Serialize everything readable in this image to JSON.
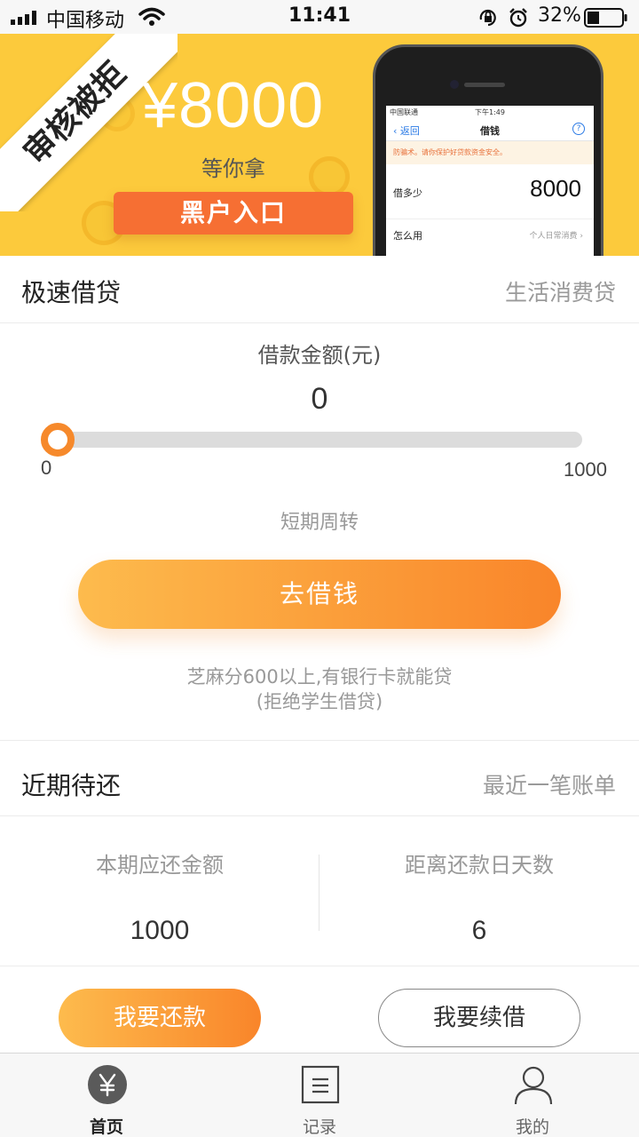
{
  "status_bar": {
    "carrier": "中国移动",
    "time": "11:41",
    "battery": "32%"
  },
  "banner": {
    "ribbon": "审核被拒",
    "amount": "¥8000",
    "subtitle": "等你拿",
    "button": "黑户入口",
    "phone": {
      "carrier": "中国联通",
      "time": "下午1:49",
      "back": "返回",
      "title": "借钱",
      "help": "?",
      "notice": "防骗术。请你保护好贷款资金安全。",
      "row1_label": "借多少",
      "row1_value": "8000",
      "row2_label": "怎么用",
      "row2_value": "个人日常消费 ›"
    }
  },
  "loan_section": {
    "title": "极速借贷",
    "side": "生活消费贷",
    "amount_label": "借款金额(元)",
    "amount_value": "0",
    "slider_min": "0",
    "slider_max": "1000",
    "slider_level": 0,
    "loan_type": "短期周转",
    "borrow_button": "去借钱",
    "note_line1": "芝麻分600以上,有银行卡就能贷",
    "note_line2": "(拒绝学生借贷)"
  },
  "repay_section": {
    "title": "近期待还",
    "side": "最近一笔账单",
    "due_label": "本期应还金额",
    "due_value": "1000",
    "days_label": "距离还款日天数",
    "days_value": "6",
    "repay_button": "我要还款",
    "renew_button": "我要续借"
  },
  "tabbar": {
    "items": [
      {
        "label": "首页",
        "icon": "yuan-icon",
        "active": true
      },
      {
        "label": "记录",
        "icon": "records-icon",
        "active": false
      },
      {
        "label": "我的",
        "icon": "user-icon",
        "active": false
      }
    ]
  },
  "colors": {
    "accent": "#f9852a",
    "banner": "#fcca3c",
    "banner_button": "#f66f33"
  }
}
